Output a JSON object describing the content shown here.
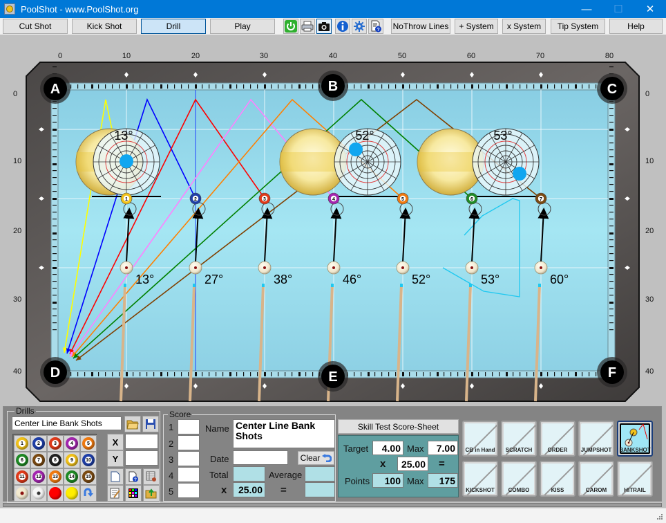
{
  "window": {
    "title": "PoolShot - www.PoolShot.org",
    "controls": {
      "minimize": "—",
      "maximize": "☐",
      "close": "✕"
    }
  },
  "toolbar": {
    "mode_buttons": [
      {
        "label": "Cut Shot",
        "active": false
      },
      {
        "label": "Kick Shot",
        "active": false
      },
      {
        "label": "Drill",
        "active": true
      },
      {
        "label": "Play",
        "active": false
      }
    ],
    "icons": [
      "power-icon",
      "printer-icon",
      "camera-icon",
      "info-icon",
      "gear-icon",
      "help-document-icon"
    ],
    "option_buttons": [
      "NoThrow Lines",
      "+ System",
      "x System",
      "Tip System",
      "Help"
    ]
  },
  "table": {
    "x_ruler": [
      "0",
      "10",
      "20",
      "30",
      "40",
      "50",
      "60",
      "70",
      "80"
    ],
    "y_ruler": [
      "0",
      "10",
      "20",
      "30",
      "40"
    ],
    "pockets": [
      "A",
      "B",
      "C",
      "D",
      "E",
      "F"
    ],
    "spin_diagrams": [
      {
        "angle_label": "13°"
      },
      {
        "angle_label": "52°"
      },
      {
        "angle_label": "53°"
      }
    ],
    "object_balls": [
      {
        "number": "1",
        "color": "#f2c21a"
      },
      {
        "number": "2",
        "color": "#1f3fa8"
      },
      {
        "number": "3",
        "color": "#e03a1a"
      },
      {
        "number": "4",
        "color": "#a426b0"
      },
      {
        "number": "5",
        "color": "#f07a10"
      },
      {
        "number": "6",
        "color": "#1f8a25"
      },
      {
        "number": "7",
        "color": "#7a4a12"
      }
    ],
    "cut_angles": [
      "13°",
      "27°",
      "38°",
      "46°",
      "52°",
      "53°",
      "60°"
    ],
    "bank_line_colors": [
      "#ffff00",
      "#0000ff",
      "#ff0000",
      "#ff80ff",
      "#ff8000",
      "#008000",
      "#804000"
    ],
    "cue_path_color": "#1ec8f0"
  },
  "drills": {
    "group_title": "Drills",
    "drill_name": "Center Line Bank Shots",
    "x_label": "X",
    "y_label": "Y",
    "x_value": "",
    "y_value": "",
    "ball_palette": [
      {
        "n": "1",
        "c": "#f2c21a"
      },
      {
        "n": "2",
        "c": "#1f3fa8"
      },
      {
        "n": "3",
        "c": "#e03a1a"
      },
      {
        "n": "4",
        "c": "#a426b0"
      },
      {
        "n": "5",
        "c": "#f07a10"
      },
      {
        "n": "6",
        "c": "#1f8a25"
      },
      {
        "n": "7",
        "c": "#7a4a12"
      },
      {
        "n": "8",
        "c": "#222222"
      },
      {
        "n": "9",
        "c": "#f2c21a"
      },
      {
        "n": "10",
        "c": "#1f3fa8"
      },
      {
        "n": "11",
        "c": "#e03a1a"
      },
      {
        "n": "12",
        "c": "#a426b0"
      },
      {
        "n": "13",
        "c": "#f07a10"
      },
      {
        "n": "14",
        "c": "#1f8a25"
      },
      {
        "n": "15",
        "c": "#7a4a12"
      }
    ]
  },
  "score": {
    "group_title": "Score",
    "rows": [
      "1",
      "2",
      "3",
      "4",
      "5"
    ],
    "row_values": [
      "",
      "",
      "",
      "",
      ""
    ],
    "name_label": "Name",
    "name_value": "Center Line Bank Shots",
    "date_label": "Date",
    "date_value": "",
    "clear_label": "Clear",
    "total_label": "Total",
    "total_value": "",
    "average_label": "Average",
    "average_value": "",
    "multiplier_symbol": "x",
    "multiplier_value": "25.00",
    "equals_symbol": "=",
    "result_value": ""
  },
  "skill_test": {
    "header": "Skill Test Score-Sheet",
    "target_label": "Target",
    "target_value": "4.00",
    "max_label": "Max",
    "max_value": "7.00",
    "x_symbol": "x",
    "multiplier_value": "25.00",
    "equals_symbol": "=",
    "points_label": "Points",
    "points_value": "100",
    "points_max_label": "Max",
    "points_max_value": "175"
  },
  "shot_types": [
    {
      "label": "CB in Hand",
      "selected": false
    },
    {
      "label": "SCRATCH",
      "selected": false
    },
    {
      "label": "ORDER",
      "selected": false
    },
    {
      "label": "JUMPSHOT",
      "selected": false
    },
    {
      "label": "BANKSHOT",
      "selected": true
    },
    {
      "label": "KICKSHOT",
      "selected": false
    },
    {
      "label": "COMBO",
      "selected": false
    },
    {
      "label": "KISS",
      "selected": false
    },
    {
      "label": "CAROM",
      "selected": false
    },
    {
      "label": "HITRAIL",
      "selected": false
    }
  ]
}
